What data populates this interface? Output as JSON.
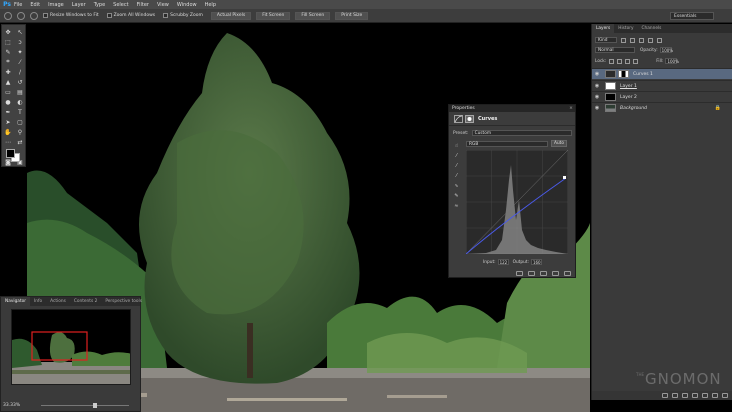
{
  "app": {
    "logo": "Ps",
    "menu": [
      "File",
      "Edit",
      "Image",
      "Layer",
      "Type",
      "Select",
      "Filter",
      "View",
      "Window",
      "Help"
    ]
  },
  "options": {
    "checks": [
      "Resize Windows to Fit",
      "Zoom All Windows",
      "Scrubby Zoom"
    ],
    "buttons": [
      "Actual Pixels",
      "Fit Screen",
      "Fill Screen",
      "Print Size"
    ],
    "workspace": "Essentials"
  },
  "navigator": {
    "tabs": [
      "Navigator",
      "Info",
      "Actions",
      "Contents 2",
      "Perspective tools"
    ],
    "zoom": "33.33%"
  },
  "properties": {
    "title": "Properties",
    "panel_name": "Curves",
    "preset_label": "Preset:",
    "preset_value": "Custom",
    "channel_value": "RGB",
    "auto_label": "Auto",
    "input_label": "Input:",
    "input_value": "122",
    "output_label": "Output:",
    "output_value": "160"
  },
  "layers": {
    "tabs": [
      "Layers",
      "History",
      "Channels"
    ],
    "filter_kind": "Kind",
    "blend_mode": "Normal",
    "opacity_label": "Opacity:",
    "opacity_value": "100%",
    "lock_label": "Lock:",
    "fill_label": "Fill:",
    "fill_value": "100%",
    "items": [
      {
        "name": "Curves 1",
        "selected": true
      },
      {
        "name": "Layer 1",
        "selected": false
      },
      {
        "name": "Layer 2",
        "selected": false
      },
      {
        "name": "Background",
        "selected": false
      }
    ]
  },
  "watermark": {
    "brand": "GNOMON",
    "sub": "THE"
  },
  "colors": {
    "accent": "#31a8ff",
    "selection": "#596980",
    "panel": "#3a3a3a"
  }
}
